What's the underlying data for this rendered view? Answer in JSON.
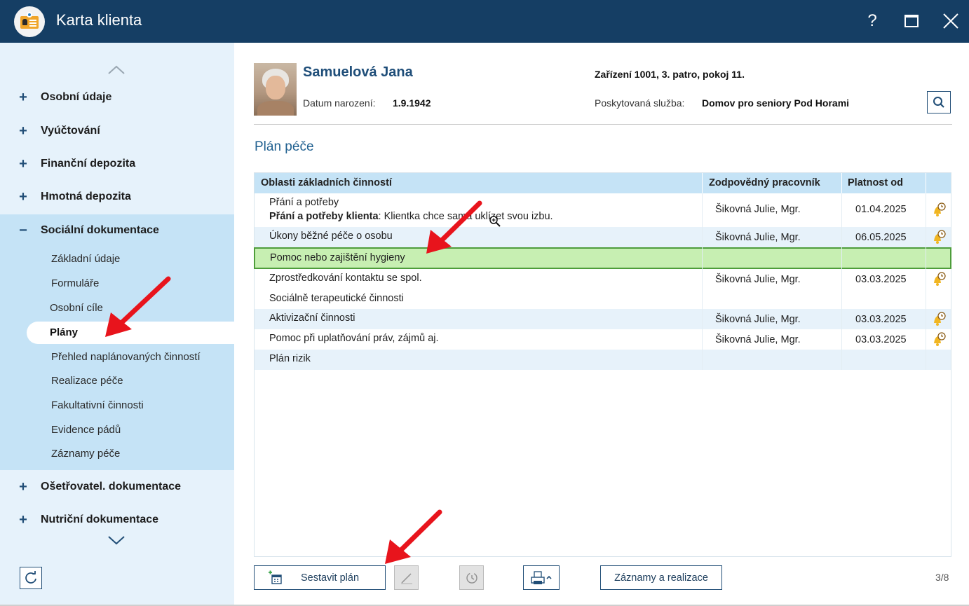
{
  "window": {
    "title": "Karta klienta",
    "help": "?",
    "close": "✕"
  },
  "sidebar": {
    "sections": [
      {
        "sign": "+",
        "label": "Osobní údaje"
      },
      {
        "sign": "+",
        "label": "Vyúčtování"
      },
      {
        "sign": "+",
        "label": "Finanční depozita"
      },
      {
        "sign": "+",
        "label": "Hmotná depozita"
      },
      {
        "sign": "−",
        "label": "Sociální dokumentace"
      },
      {
        "sign": "+",
        "label": "Ošetřovatel. dokumentace"
      },
      {
        "sign": "+",
        "label": "Nutriční dokumentace"
      }
    ],
    "subitems": [
      "Základní údaje",
      "Formuláře",
      "Osobní cíle",
      "Plány",
      "Přehled naplánovaných činností",
      "Realizace péče",
      "Fakultativní činnosti",
      "Evidence pádů",
      "Záznamy péče"
    ],
    "active_subitem": "Plány"
  },
  "client": {
    "name": "Samuelová Jana",
    "dob_label": "Datum narození:",
    "dob": "1.9.1942",
    "facility": "Zařízení 1001, 3. patro, pokoj 11.",
    "service_label": "Poskytovaná služba:",
    "service": "Domov pro seniory Pod Horami"
  },
  "main": {
    "section_title": "Plán péče",
    "columns": [
      "Oblasti základních činností",
      "Zodpovědný pracovník",
      "Platnost od"
    ],
    "rows": [
      {
        "area": "Přání a potřeby",
        "note_bold": "Přání a potřeby klienta",
        "note": ": Klientka chce sama uklízet svou izbu.",
        "worker": "Šikovná Julie, Mgr.",
        "date": "01.04.2025",
        "bell": true
      },
      {
        "area": "Úkony běžné péče o osobu",
        "worker": "Šikovná Julie, Mgr.",
        "date": "06.05.2025",
        "bell": true
      },
      {
        "area": "Pomoc nebo zajištění hygieny",
        "worker": "",
        "date": "",
        "bell": false,
        "selected": true
      },
      {
        "area": "Zprostředkování kontaktu se spol.",
        "worker": "Šikovná Julie, Mgr.",
        "date": "03.03.2025",
        "bell": true
      },
      {
        "area": "Sociálně terapeutické činnosti",
        "worker": "",
        "date": "",
        "bell": false
      },
      {
        "area": "Aktivizační činnosti",
        "worker": "Šikovná Julie, Mgr.",
        "date": "03.03.2025",
        "bell": true
      },
      {
        "area": "Pomoc při uplatňování práv, zájmů aj.",
        "worker": "Šikovná Julie, Mgr.",
        "date": "03.03.2025",
        "bell": true
      },
      {
        "area": "Plán rizik",
        "worker": "",
        "date": "",
        "bell": false
      }
    ]
  },
  "toolbar": {
    "build_plan": "Sestavit plán",
    "records": "Záznamy a realizace",
    "page_count": "3/8"
  },
  "colors": {
    "titlebar": "#153e64",
    "sidebar": "#e6f2fb",
    "sidebar_open": "#c5e3f6",
    "selected_row": "#c7efb2",
    "selected_border": "#4e9d3b",
    "annotation": "#e8141c"
  },
  "icons": {
    "app": "client-card-icon",
    "search": "search-icon",
    "refresh": "refresh-icon",
    "bell": "bell-clock-icon",
    "print": "printer-icon",
    "edit": "pencil-icon",
    "history": "history-icon",
    "add_plan": "calendar-add-icon"
  }
}
